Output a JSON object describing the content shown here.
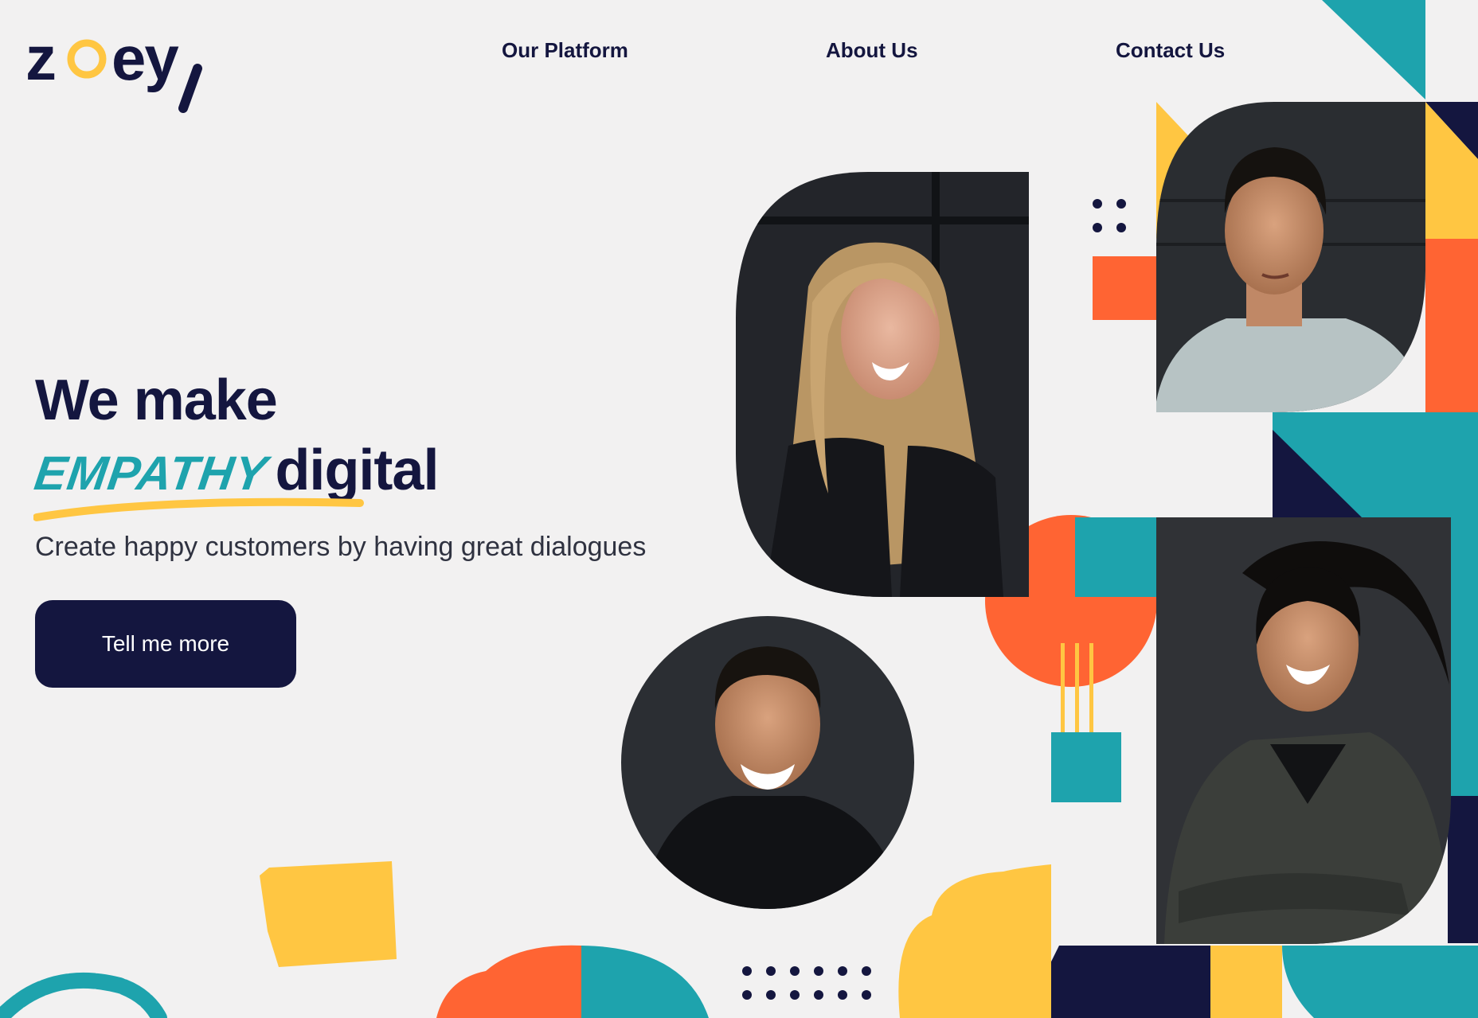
{
  "brand": {
    "name": "zoey"
  },
  "nav": {
    "items": [
      {
        "label": "Our Platform"
      },
      {
        "label": "About Us"
      },
      {
        "label": "Contact Us"
      }
    ]
  },
  "hero": {
    "line1": "We make",
    "emphasis": "EMPATHY",
    "line2_rest": "digital",
    "subtitle": "Create happy customers by having great dialogues",
    "cta_label": "Tell me more"
  },
  "colors": {
    "navy": "#14163f",
    "teal": "#1ea3ad",
    "orange": "#ff6433",
    "yellow": "#ffc642",
    "background": "#f2f1f1"
  },
  "portraits": [
    {
      "name": "portrait-woman-blonde"
    },
    {
      "name": "portrait-man-grey-sweater"
    },
    {
      "name": "portrait-man-black-jacket"
    },
    {
      "name": "portrait-woman-dark-blazer"
    }
  ]
}
